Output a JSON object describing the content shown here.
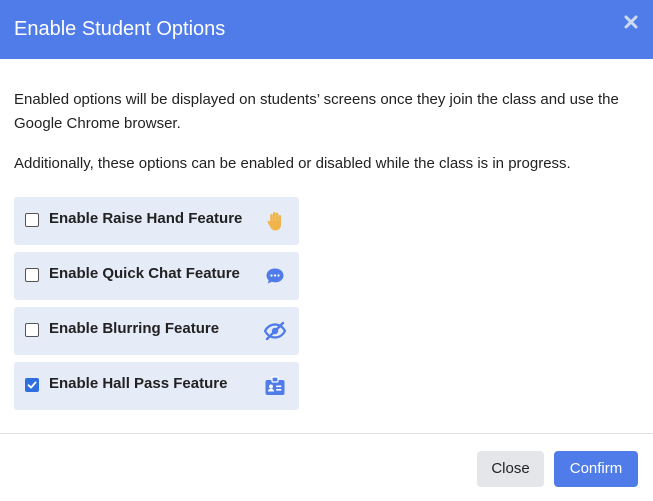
{
  "dialog": {
    "title": "Enable Student Options",
    "description_1": "Enabled options will be displayed on students’ screens once they join the class and use the Google Chrome browser.",
    "description_2": "Additionally, these options can be enabled or disabled while the class is in progress."
  },
  "options": [
    {
      "label": "Enable Raise Hand Feature",
      "checked": false,
      "icon": "raise-hand-icon",
      "icon_color": "#f0b44c"
    },
    {
      "label": "Enable Quick Chat Feature",
      "checked": false,
      "icon": "chat-bubble-icon",
      "icon_color": "#4f7ce8"
    },
    {
      "label": "Enable Blurring Feature",
      "checked": false,
      "icon": "eye-slash-icon",
      "icon_color": "#4f7ce8"
    },
    {
      "label": "Enable Hall Pass Feature",
      "checked": true,
      "icon": "id-badge-icon",
      "icon_color": "#4f7ce8"
    }
  ],
  "footer": {
    "close_label": "Close",
    "confirm_label": "Confirm"
  },
  "colors": {
    "header_bg": "#4f7ce8",
    "option_bg": "#e6ebf8",
    "accent": "#4f7ce8",
    "checkbox_checked": "#2f6fe0"
  }
}
